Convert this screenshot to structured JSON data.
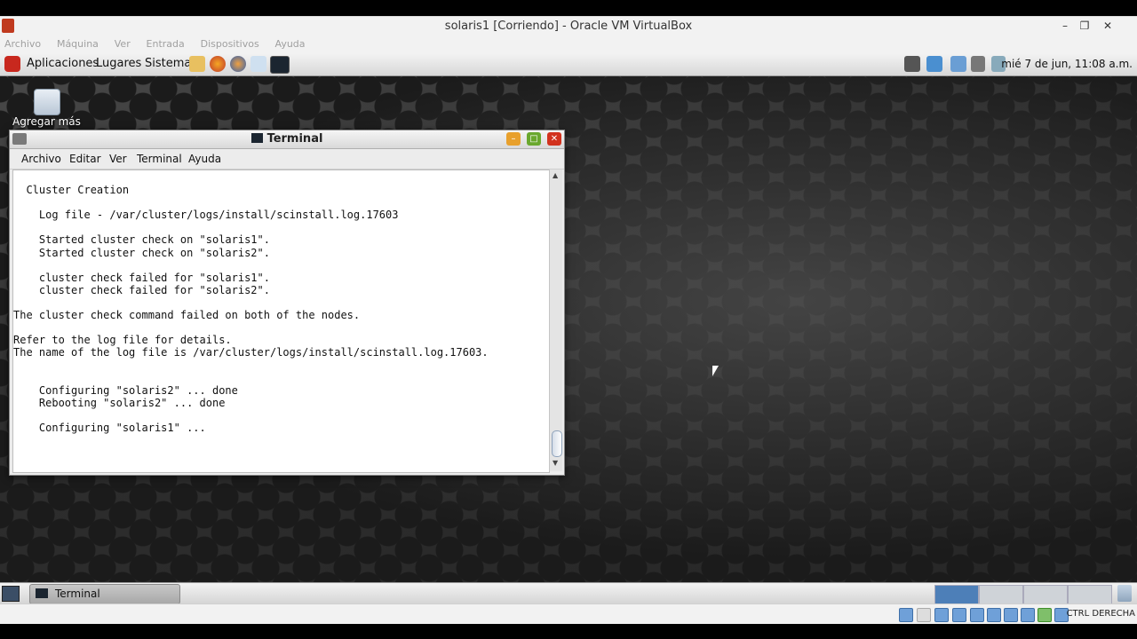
{
  "vbox": {
    "title": "solaris1 [Corriendo] - Oracle VM VirtualBox",
    "menu": [
      "Archivo",
      "Máquina",
      "Ver",
      "Entrada",
      "Dispositivos",
      "Ayuda"
    ],
    "host_key": "CTRL DERECHA"
  },
  "panel": {
    "menus": [
      "Aplicaciones",
      "Lugares",
      "Sistema"
    ],
    "clock": "mié  7 de jun, 11:08 a.m."
  },
  "desktop": {
    "icon_label": "Agregar más"
  },
  "terminal": {
    "title": "Terminal",
    "menu": [
      "Archivo",
      "Editar",
      "Ver",
      "Terminal",
      "Ayuda"
    ],
    "lines": [
      "  Cluster Creation",
      "",
      "    Log file - /var/cluster/logs/install/scinstall.log.17603",
      "",
      "    Started cluster check on \"solaris1\".",
      "    Started cluster check on \"solaris2\".",
      "",
      "    cluster check failed for \"solaris1\".",
      "    cluster check failed for \"solaris2\".",
      "",
      "The cluster check command failed on both of the nodes.",
      "",
      "Refer to the log file for details.",
      "The name of the log file is /var/cluster/logs/install/scinstall.log.17603.",
      "",
      "",
      "    Configuring \"solaris2\" ... done",
      "    Rebooting \"solaris2\" ... done",
      "",
      "    Configuring \"solaris1\" ..."
    ]
  },
  "taskbar": {
    "task_label": "Terminal"
  }
}
